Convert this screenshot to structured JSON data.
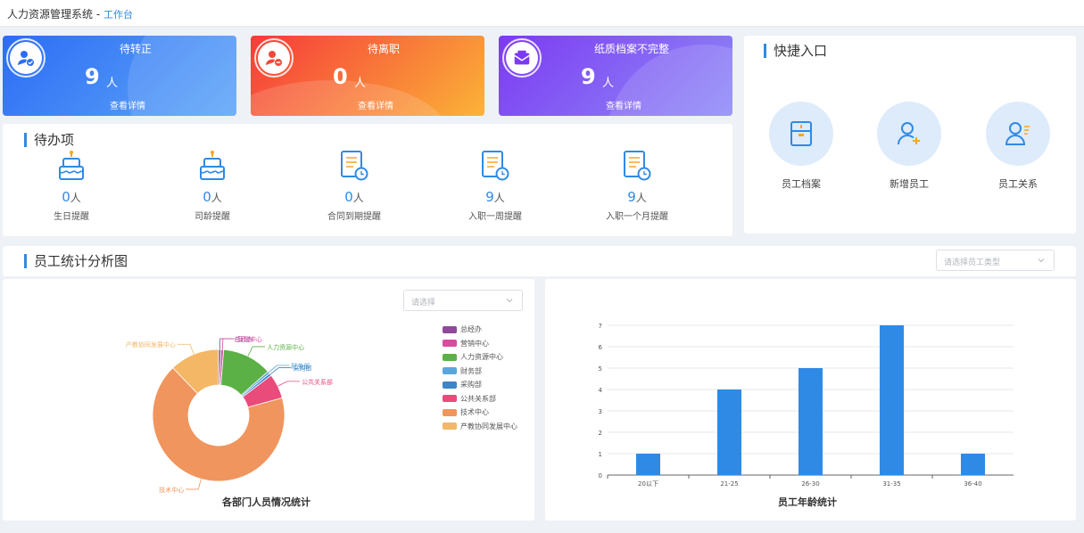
{
  "header": {
    "app_title": "人力资源管理系统",
    "separator": "-",
    "breadcrumb": "工作台"
  },
  "stats": [
    {
      "label": "待转正",
      "value": "9",
      "unit": "人",
      "link": "查看详情",
      "icon": "user-check-icon",
      "colors": [
        "#2c6cf6",
        "#5fa6f7"
      ]
    },
    {
      "label": "待离职",
      "value": "0",
      "unit": "人",
      "link": "查看详情",
      "icon": "user-minus-icon",
      "colors": [
        "#f63a3a",
        "#fbb338"
      ]
    },
    {
      "label": "纸质档案不完整",
      "value": "9",
      "unit": "人",
      "link": "查看详情",
      "icon": "mail-icon",
      "colors": [
        "#7c3af2",
        "#8f8bf7"
      ]
    }
  ],
  "todo": {
    "title": "待办项",
    "items": [
      {
        "value": "0",
        "unit": "人",
        "label": "生日提醒",
        "icon": "birthday-cake-icon"
      },
      {
        "value": "0",
        "unit": "人",
        "label": "司龄提醒",
        "icon": "anniversary-cake-icon"
      },
      {
        "value": "0",
        "unit": "人",
        "label": "合同到期提醒",
        "icon": "contract-clock-icon"
      },
      {
        "value": "9",
        "unit": "人",
        "label": "入职一周提醒",
        "icon": "onboard-week-icon"
      },
      {
        "value": "9",
        "unit": "人",
        "label": "入职一个月提醒",
        "icon": "onboard-month-icon"
      }
    ]
  },
  "quick": {
    "title": "快捷入口",
    "items": [
      {
        "label": "员工档案",
        "icon": "archive-icon"
      },
      {
        "label": "新增员工",
        "icon": "add-user-icon"
      },
      {
        "label": "员工关系",
        "icon": "user-relation-icon"
      }
    ]
  },
  "analysis": {
    "title": "员工统计分析图",
    "type_select_placeholder": "请选择员工类型",
    "dept_select_placeholder": "请选择"
  },
  "chart_data": [
    {
      "type": "pie",
      "title": "各部门人员情况统计",
      "donut": true,
      "legend_position": "right",
      "categories": [
        "总经办",
        "营销中心",
        "人力资源中心",
        "财务部",
        "采购部",
        "公共关系部",
        "技术中心",
        "产教协同发展中心"
      ],
      "values": [
        0.1,
        0.1,
        2,
        0.1,
        0.1,
        1,
        11,
        2
      ],
      "colors": [
        "#8e4a99",
        "#d84b9f",
        "#5cb146",
        "#5aa6dc",
        "#3d86c6",
        "#e94b7b",
        "#f0955d",
        "#f3b766"
      ]
    },
    {
      "type": "bar",
      "title": "员工年龄统计",
      "categories": [
        "20以下",
        "21-25",
        "26-30",
        "31-35",
        "36-40"
      ],
      "values": [
        1,
        4,
        5,
        7,
        1
      ],
      "ylim": [
        0,
        7
      ],
      "yticks": [
        "0",
        "1",
        "2",
        "3",
        "4",
        "5",
        "6",
        "7"
      ],
      "grid": true,
      "color": "#2f8ae5"
    }
  ]
}
